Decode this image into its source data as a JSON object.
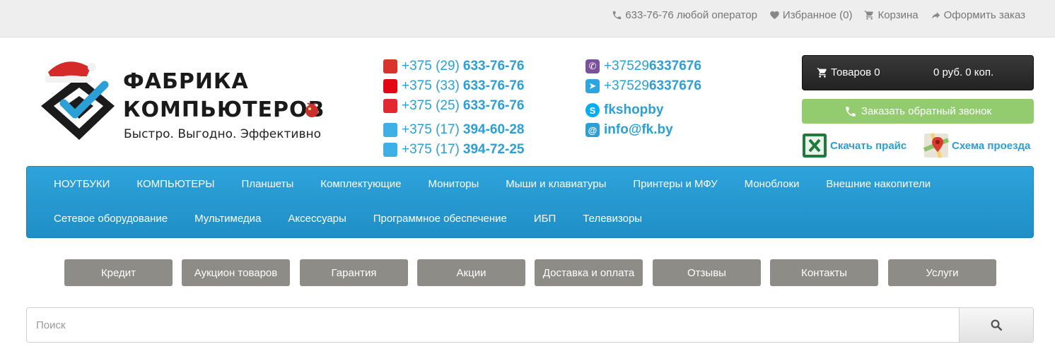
{
  "topbar": {
    "phone": "633-76-76 любой оператор",
    "favorites": "Избранное (0)",
    "cart": "Корзина",
    "checkout": "Оформить заказ"
  },
  "logo": {
    "line1": "ФАБРИКА",
    "line2": "КОМПЬЮТЕРОВ",
    "slogan": "Быстро. Выгодно. Эффективно"
  },
  "phones": [
    {
      "prefix": "+375 (29)",
      "number": "633-76-76",
      "icon": "a1-operator-icon",
      "color": "#d9342b"
    },
    {
      "prefix": "+375 (33)",
      "number": "633-76-76",
      "icon": "mts-operator-icon",
      "color": "#e30613"
    },
    {
      "prefix": "+375 (25)",
      "number": "633-76-76",
      "icon": "life-operator-icon",
      "color": "#e4282f"
    },
    {
      "prefix": "+375 (17)",
      "number": "394-60-28",
      "icon": "fax-icon",
      "color": "#3fb0e5"
    },
    {
      "prefix": "+375 (17)",
      "number": "394-72-25",
      "icon": "landline-phone-icon",
      "color": "#3fb0e5"
    }
  ],
  "contacts": [
    {
      "prefix": "+37529",
      "value": "6337676",
      "icon": "viber-icon",
      "color": "#7b519d"
    },
    {
      "prefix": "+37529",
      "value": "6337676",
      "icon": "telegram-icon",
      "color": "#2ca5e0"
    },
    {
      "prefix": "",
      "value": "fkshopby",
      "icon": "skype-icon",
      "color": "#00aff0"
    },
    {
      "prefix": "",
      "value": "info@fk.by",
      "icon": "email-icon",
      "color": "#2b9fd6"
    }
  ],
  "cart": {
    "items": "Товаров 0",
    "sum": "0 руб. 0 коп."
  },
  "callback": "Заказать обратный звонок",
  "download_price": "Скачать прайс",
  "directions": "Схема проезда",
  "nav": {
    "row1": [
      "НОУТБУКИ",
      "КОМПЬЮТЕРЫ",
      "Планшеты",
      "Комплектующие",
      "Мониторы",
      "Мыши и клавиатуры",
      "Принтеры и МФУ",
      "Моноблоки",
      "Внешние накопители"
    ],
    "row2": [
      "Сетевое оборудование",
      "Мультимедиа",
      "Аксессуары",
      "Программное обеспечение",
      "ИБП",
      "Телевизоры"
    ]
  },
  "buttons": [
    "Кредит",
    "Аукцион товаров",
    "Гарантия",
    "Акции",
    "Доставка и оплата",
    "Отзывы",
    "Контакты",
    "Услуги"
  ],
  "search": {
    "placeholder": "Поиск"
  },
  "colors": {
    "accent": "#2b9fd6",
    "nav_bg": "#2599d1",
    "gray_button": "#8d8c86",
    "callback": "#92cc6f",
    "cart_bg": "#2a2a2a"
  }
}
